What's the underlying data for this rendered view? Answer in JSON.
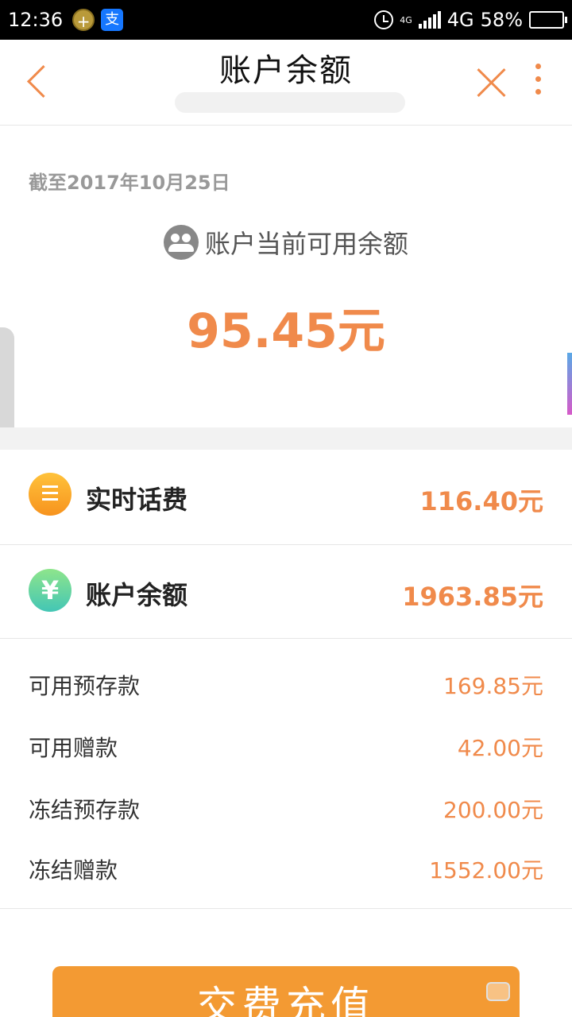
{
  "status_bar": {
    "time": "12:36",
    "network_small": "4G",
    "network": "4G",
    "battery": "58%",
    "battery_level": 0.58
  },
  "nav": {
    "title": "账户余额"
  },
  "summary": {
    "as_of": "截至2017年10月25日",
    "available_label": "账户当前可用余额",
    "available_amount": "95.45元"
  },
  "rows": {
    "bill": {
      "label": "实时话费",
      "value": "116.40元"
    },
    "balance": {
      "label": "账户余额",
      "value": "1963.85元",
      "icon_glyph": "¥"
    }
  },
  "details": [
    {
      "label": "可用预存款",
      "value": "169.85元"
    },
    {
      "label": "可用赠款",
      "value": "42.00元"
    },
    {
      "label": "冻结预存款",
      "value": "200.00元"
    },
    {
      "label": "冻结赠款",
      "value": "1552.00元"
    }
  ],
  "actions": {
    "recharge_label": "交费充值"
  },
  "colors": {
    "accent": "#f08a4b",
    "button": "#f39a33",
    "bill_icon": "#f7931e",
    "balance_icon": "#43c6b5"
  },
  "icons": {
    "back": "chevron-left-icon",
    "close": "close-icon",
    "more": "more-vertical-icon",
    "users": "users-icon",
    "bill": "list-icon",
    "balance": "yen-icon"
  }
}
